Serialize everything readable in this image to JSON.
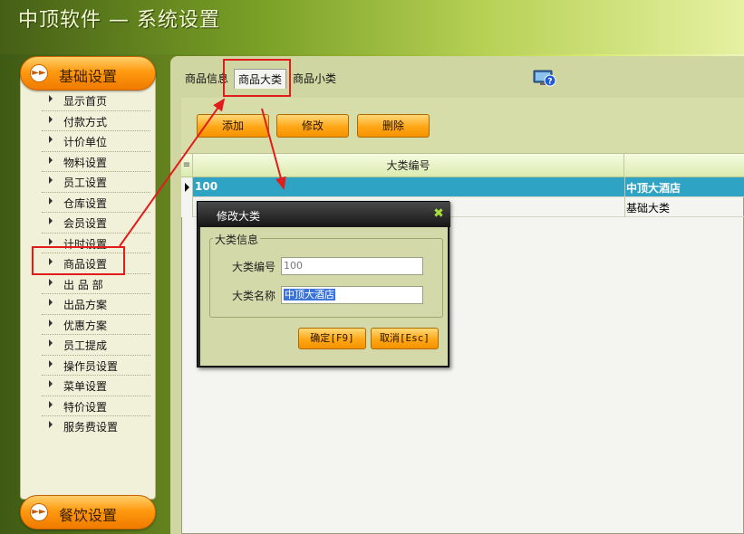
{
  "app": {
    "title": "中顶软件 — 系统设置"
  },
  "sidebar": {
    "top_header": "基础设置",
    "bottom_header": "餐饮设置",
    "items": [
      {
        "label": "显示首页"
      },
      {
        "label": "付款方式"
      },
      {
        "label": "计价单位"
      },
      {
        "label": "物料设置"
      },
      {
        "label": "员工设置"
      },
      {
        "label": "仓库设置"
      },
      {
        "label": "会员设置"
      },
      {
        "label": "计时设置"
      },
      {
        "label": "商品设置"
      },
      {
        "label": "出 品 部"
      },
      {
        "label": "出品方案"
      },
      {
        "label": "优惠方案"
      },
      {
        "label": "员工提成"
      },
      {
        "label": "操作员设置"
      },
      {
        "label": "菜单设置"
      },
      {
        "label": "特价设置"
      },
      {
        "label": "服务费设置"
      }
    ]
  },
  "tabs": [
    {
      "label": "商品信息"
    },
    {
      "label": "商品大类"
    },
    {
      "label": "商品小类"
    }
  ],
  "toolbar": {
    "add_label": "添加",
    "edit_label": "修改",
    "delete_label": "删除"
  },
  "grid": {
    "header_col1": "大类编号",
    "rows": [
      {
        "code": "100",
        "name": "中顶大酒店"
      },
      {
        "code": "",
        "name": "基础大类"
      }
    ]
  },
  "dialog": {
    "title": "修改大类",
    "group_title": "大类信息",
    "code_label": "大类编号",
    "code_value": "100",
    "name_label": "大类名称",
    "name_value": "中顶大酒店",
    "ok_label": "确定[F9]",
    "cancel_label": "取消[Esc]"
  }
}
